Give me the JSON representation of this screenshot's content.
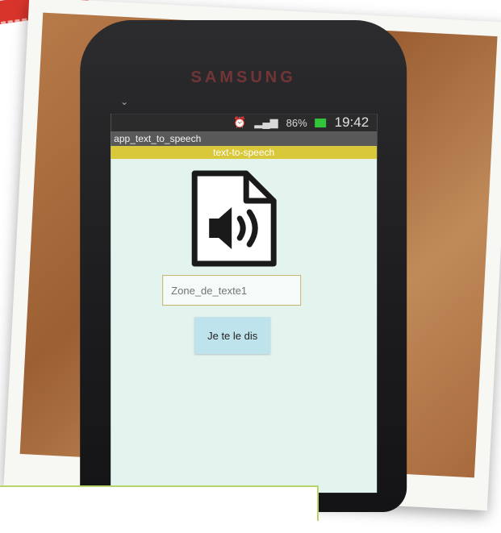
{
  "phone": {
    "brand": "SAMSUNG"
  },
  "status_bar": {
    "clock": "19:42",
    "battery": "86%"
  },
  "app": {
    "title": "app_text_to_speech",
    "screen_title": "text-to-speech",
    "text_field_placeholder": "Zone_de_texte1",
    "speak_button_label": "Je te le dis"
  },
  "colors": {
    "title_bar": "#595959",
    "header_bar": "#d9c83a",
    "screen_bg": "#e3f3ee",
    "button_bg": "#bfe3ec"
  }
}
